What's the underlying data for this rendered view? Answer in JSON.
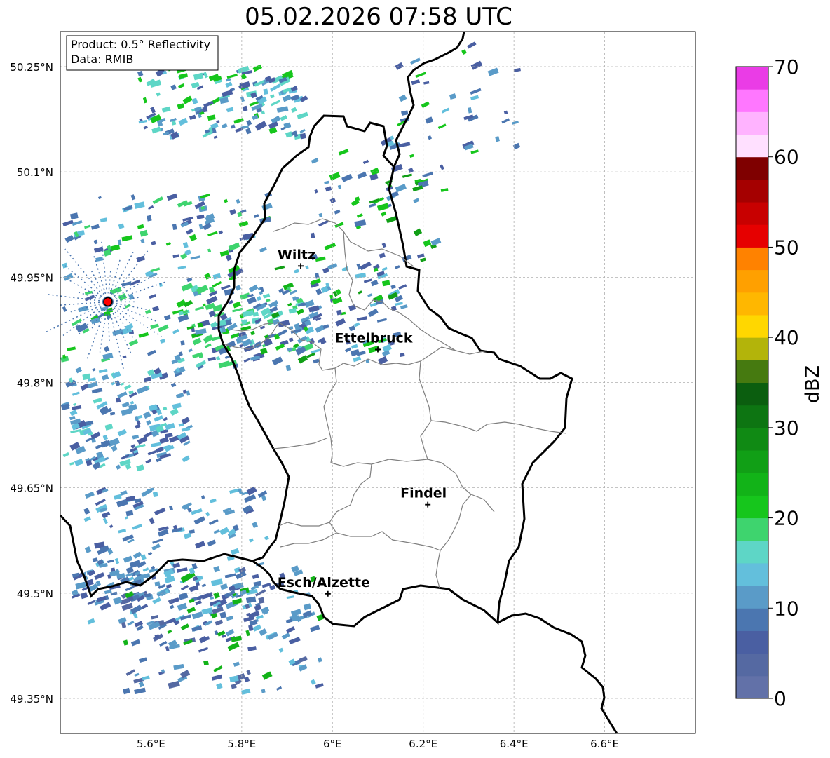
{
  "title": "05.02.2026 07:58 UTC",
  "info_box": {
    "product": "Product: 0.5° Reflectivity",
    "data": "Data: RMIB"
  },
  "lat_ticks": [
    {
      "lat": 50.25,
      "label": "50.25°N"
    },
    {
      "lat": 50.1,
      "label": "50.1°N"
    },
    {
      "lat": 49.95,
      "label": "49.95°N"
    },
    {
      "lat": 49.8,
      "label": "49.8°N"
    },
    {
      "lat": 49.65,
      "label": "49.65°N"
    },
    {
      "lat": 49.5,
      "label": "49.5°N"
    },
    {
      "lat": 49.35,
      "label": "49.35°N"
    }
  ],
  "lon_ticks": [
    {
      "lon": 5.6,
      "label": "5.6°E"
    },
    {
      "lon": 5.8,
      "label": "5.8°E"
    },
    {
      "lon": 6.0,
      "label": "6°E"
    },
    {
      "lon": 6.2,
      "label": "6.2°E"
    },
    {
      "lon": 6.4,
      "label": "6.4°E"
    },
    {
      "lon": 6.6,
      "label": "6.6°E"
    }
  ],
  "extent": {
    "lon_min": 5.4,
    "lon_max": 6.8,
    "lat_min": 49.3,
    "lat_max": 50.3
  },
  "cities": [
    {
      "name": "Wiltz",
      "lon": 5.93,
      "lat": 49.966
    },
    {
      "name": "Ettelbruck",
      "lon": 6.1,
      "lat": 49.847
    },
    {
      "name": "Findel",
      "lon": 6.21,
      "lat": 49.626
    },
    {
      "name": "Esch/Alzette",
      "lon": 5.99,
      "lat": 49.499
    }
  ],
  "radar_site": {
    "lon": 5.505,
    "lat": 49.915,
    "color": "#ff0000"
  },
  "colorbar": {
    "label": "dBZ",
    "ticks": [
      0,
      10,
      20,
      30,
      40,
      50,
      60,
      70
    ],
    "min": 0,
    "max": 70,
    "colors": [
      "#6271a8",
      "#5569a2",
      "#4a5fa2",
      "#4b76b0",
      "#5a9bc8",
      "#63bfdc",
      "#5ed6c6",
      "#3ed46e",
      "#16c61c",
      "#12b318",
      "#119f16",
      "#108a14",
      "#0d7512",
      "#0b5e0f",
      "#467a10",
      "#b3b40a",
      "#ffd700",
      "#ffb700",
      "#ffa000",
      "#ff8200",
      "#e60000",
      "#c80000",
      "#a50000",
      "#7f0000",
      "#ffe0ff",
      "#ffb3ff",
      "#ff77ff",
      "#ea3ce6"
    ]
  },
  "colors": {
    "border": "#000000",
    "canton": "#7f7f7f",
    "grid": "#b0b0b0"
  }
}
